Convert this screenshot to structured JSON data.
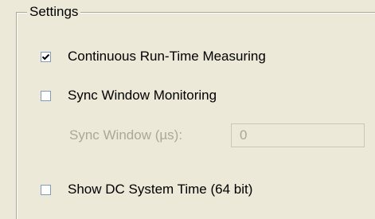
{
  "settings": {
    "title": "Settings",
    "continuous_runtime": {
      "label": "Continuous Run-Time Measuring",
      "checked": true
    },
    "sync_window_monitoring": {
      "label": "Sync Window Monitoring",
      "checked": false
    },
    "sync_window": {
      "label": "Sync Window (µs):",
      "value": "0",
      "enabled": false
    },
    "show_dc_system_time": {
      "label": "Show DC System Time (64 bit)",
      "checked": false
    }
  },
  "icons": {
    "checkmark": "checkmark-icon"
  },
  "colors": {
    "background": "#ece9d8",
    "checkbox_border": "#7f9db9",
    "disabled_text": "#aca899"
  }
}
